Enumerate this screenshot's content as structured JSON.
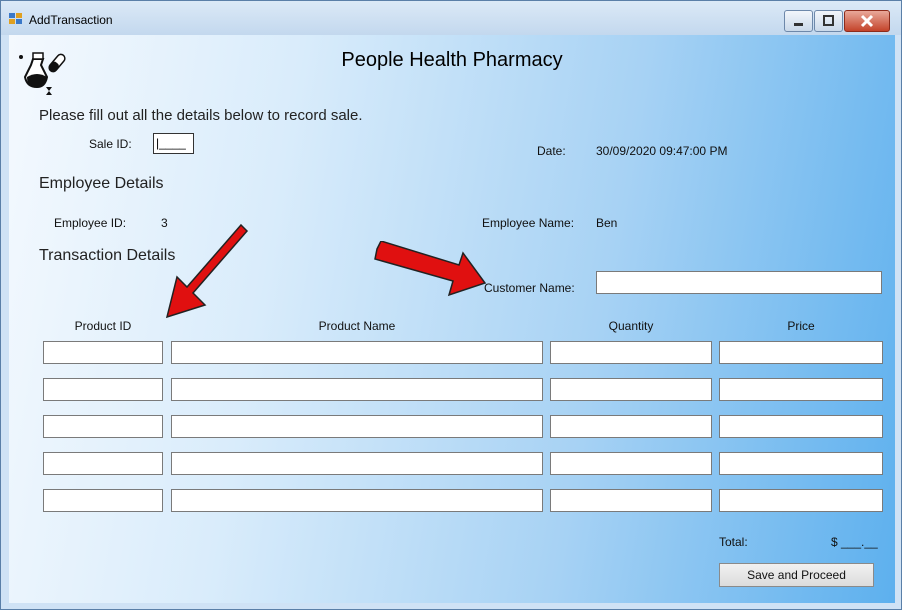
{
  "window": {
    "title": "AddTransaction"
  },
  "heading": "People Health Pharmacy",
  "intro": "Please fill out all the details below to record sale.",
  "sale": {
    "label": "Sale ID:",
    "value": "|____",
    "date_label": "Date:",
    "date_value": "30/09/2020 09:47:00 PM"
  },
  "employee": {
    "section": "Employee Details",
    "id_label": "Employee ID:",
    "id_value": "3",
    "name_label": "Employee Name:",
    "name_value": "Ben"
  },
  "transaction": {
    "section": "Transaction Details",
    "customer_label": "Customer Name:",
    "customer_value": "",
    "columns": [
      "Product ID",
      "Product Name",
      "Quantity",
      "Price"
    ],
    "rows": [
      [
        "",
        "",
        "",
        ""
      ],
      [
        "",
        "",
        "",
        ""
      ],
      [
        "",
        "",
        "",
        ""
      ],
      [
        "",
        "",
        "",
        ""
      ],
      [
        "",
        "",
        "",
        ""
      ]
    ]
  },
  "total": {
    "label": "Total:",
    "value": "$ ___.__"
  },
  "buttons": {
    "save": "Save and Proceed"
  },
  "colors": {
    "annotation_arrow": "#e01010"
  }
}
